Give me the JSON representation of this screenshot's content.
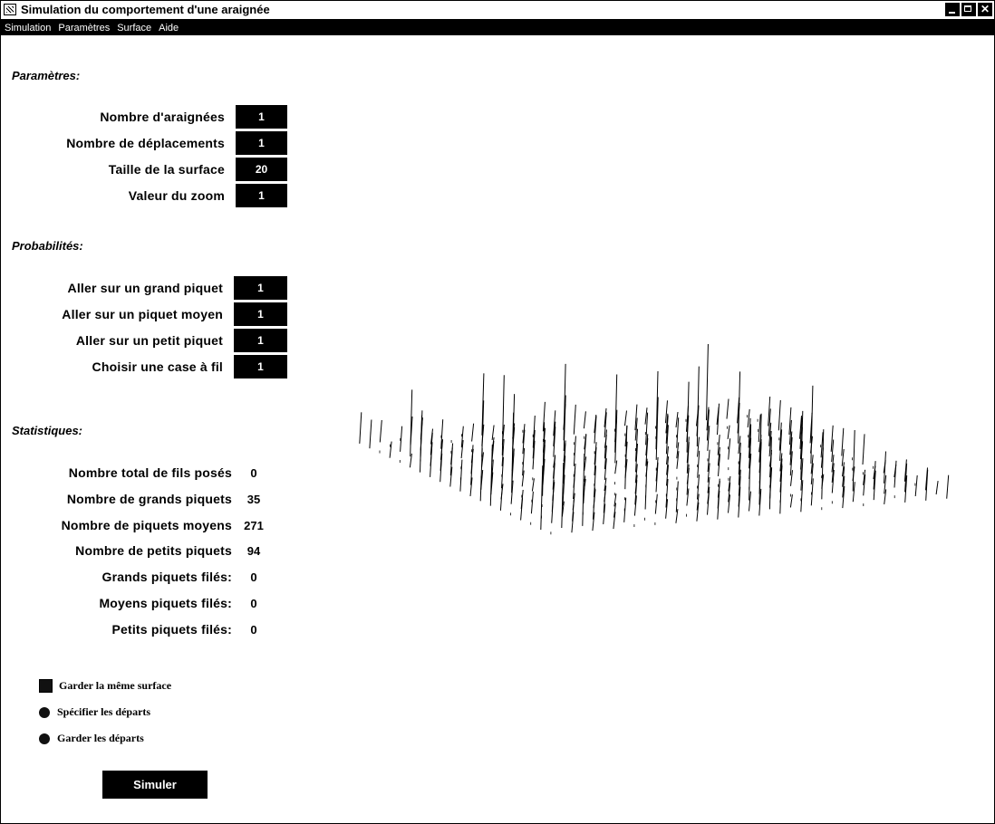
{
  "window": {
    "title": "Simulation du comportement d'une araignée",
    "buttons": [
      "minimize",
      "maximize",
      "close"
    ]
  },
  "menu": [
    "Simulation",
    "Paramètres",
    "Surface",
    "Aide"
  ],
  "parametres": {
    "heading": "Paramètres:",
    "rows": [
      {
        "label": "Nombre d'araignées",
        "value": "1"
      },
      {
        "label": "Nombre de déplacements",
        "value": "1"
      },
      {
        "label": "Taille de la surface",
        "value": "20"
      },
      {
        "label": "Valeur du zoom",
        "value": "1"
      }
    ]
  },
  "probabilites": {
    "heading": "Probabilités:",
    "rows": [
      {
        "label": "Aller sur un grand piquet",
        "value": "1"
      },
      {
        "label": "Aller sur un piquet moyen",
        "value": "1"
      },
      {
        "label": "Aller sur un petit piquet",
        "value": "1"
      },
      {
        "label": "Choisir une case à fil",
        "value": "1"
      }
    ]
  },
  "statistiques": {
    "heading": "Statistiques:",
    "rows": [
      {
        "label": "Nombre total de fils posés",
        "value": "0"
      },
      {
        "label": "Nombre de grands piquets",
        "value": "35"
      },
      {
        "label": "Nombre de piquets moyens",
        "value": "271"
      },
      {
        "label": "Nombre de petits piquets",
        "value": "94"
      },
      {
        "label": "Grands piquets filés:",
        "value": "0"
      },
      {
        "label": "Moyens piquets filés:",
        "value": "0"
      },
      {
        "label": "Petits piquets filés:",
        "value": "0"
      }
    ]
  },
  "options": {
    "keep_surface": {
      "label": "Garder la même surface",
      "checked": true
    },
    "specify_starts": {
      "label": "Spécifier les départs",
      "selected": true
    },
    "keep_starts": {
      "label": "Garder les départs",
      "selected": true
    }
  },
  "simulate_label": "Simuler",
  "surface_view": {
    "grid_size": 20,
    "stake_counts": {
      "grands": 35,
      "moyens": 271,
      "petits": 94
    },
    "stroke_color": "#000000"
  }
}
